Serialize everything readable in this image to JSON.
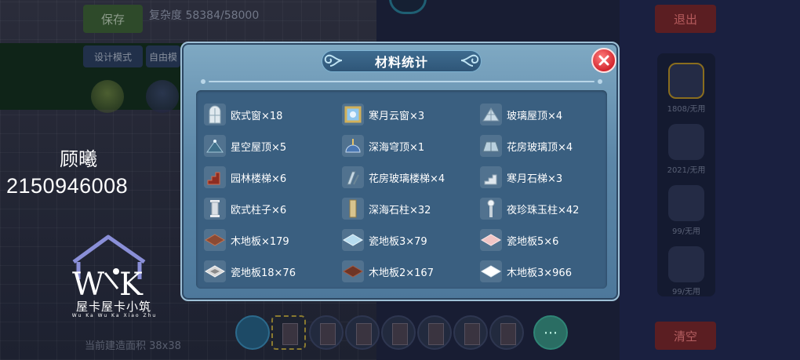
{
  "background": {
    "save_button": "保存",
    "complexity": "复杂度 58384/58000",
    "mode_button": "设计模式",
    "free_button": "自由模",
    "exit_button": "退出",
    "clear_button": "清空",
    "dock_counts": [
      "1808/无用",
      "2021/无用",
      "99/无用",
      "99/无用"
    ],
    "footer_text": "当前建造面积 38x38"
  },
  "watermark": {
    "name": "顾曦",
    "id": "2150946008",
    "logo_text": "屋卡屋卡小筑",
    "logo_sub": "Wu Ka Wu Ka Xiao Zhu"
  },
  "dialog": {
    "title": "材料统计",
    "items": [
      {
        "label": "欧式窗×18",
        "icon": "window-icon"
      },
      {
        "label": "寒月云窗×3",
        "icon": "ornate-window-icon"
      },
      {
        "label": "玻璃屋顶×4",
        "icon": "glass-pyramid-icon"
      },
      {
        "label": "星空屋顶×5",
        "icon": "star-roof-icon"
      },
      {
        "label": "深海穹顶×1",
        "icon": "dome-icon"
      },
      {
        "label": "花房玻璃顶×4",
        "icon": "greenhouse-roof-icon"
      },
      {
        "label": "园林楼梯×6",
        "icon": "garden-stairs-icon"
      },
      {
        "label": "花房玻璃楼梯×4",
        "icon": "glass-stairs-icon"
      },
      {
        "label": "寒月石梯×3",
        "icon": "stone-stairs-icon"
      },
      {
        "label": "欧式柱子×6",
        "icon": "column-icon"
      },
      {
        "label": "深海石柱×32",
        "icon": "pillar-icon"
      },
      {
        "label": "夜珍珠玉柱×42",
        "icon": "pearl-pillar-icon"
      },
      {
        "label": "木地板×179",
        "icon": "wood-floor-icon"
      },
      {
        "label": "瓷地板3×79",
        "icon": "tile-floor-blue-icon"
      },
      {
        "label": "瓷地板5×6",
        "icon": "tile-floor-pink-icon"
      },
      {
        "label": "瓷地板18×76",
        "icon": "tile-floor-pattern-icon"
      },
      {
        "label": "木地板2×167",
        "icon": "wood-floor-dark-icon"
      },
      {
        "label": "木地板3×966",
        "icon": "white-floor-icon"
      }
    ]
  }
}
